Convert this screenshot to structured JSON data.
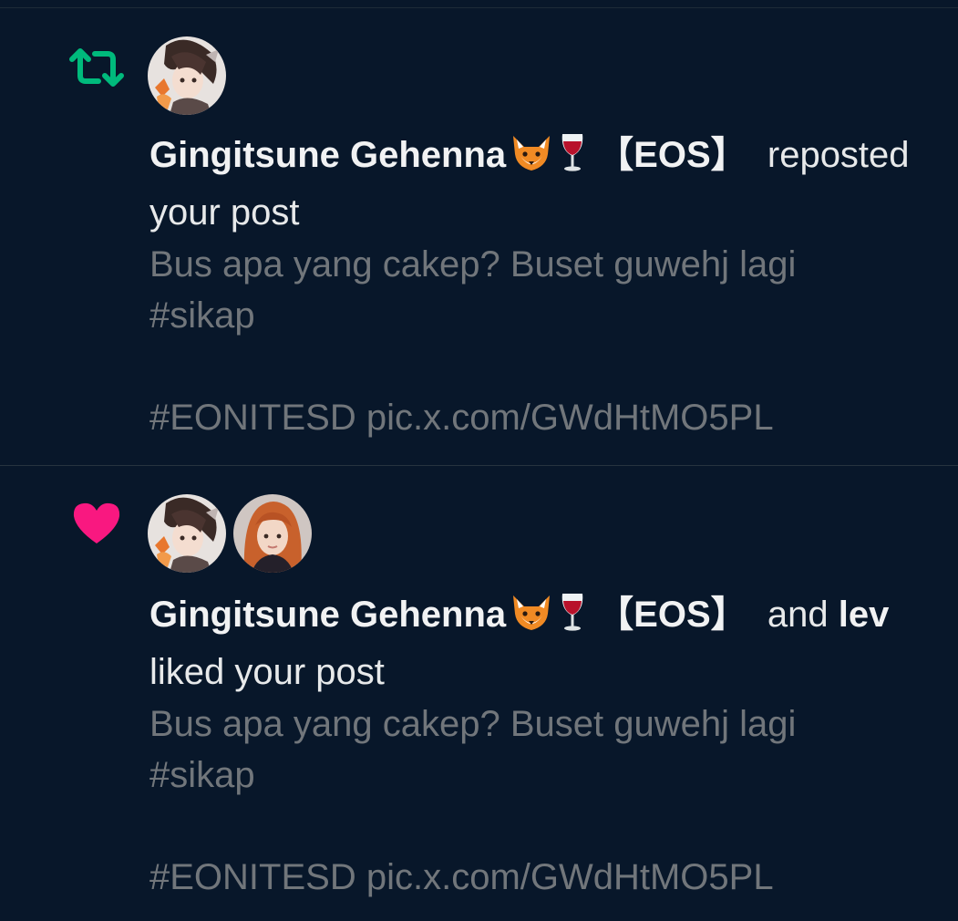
{
  "notifications": [
    {
      "type": "repost",
      "icon": "repost-icon",
      "icon_color": "#00ba7c",
      "actor_name": "Gingitsune Gehenna",
      "actor_emojis": [
        "🦊",
        "🍷"
      ],
      "actor_tag": "【EOS】",
      "action": "reposted your post",
      "post_lines": [
        "Bus apa yang cakep? Buset guwehj lagi",
        "#sikap",
        "",
        "#EONITESD pic.x.com/GWdHtMO5PL"
      ]
    },
    {
      "type": "like",
      "icon": "heart-icon",
      "icon_color": "#f91880",
      "actor_name": "Gingitsune Gehenna",
      "actor_emojis": [
        "🦊",
        "🍷"
      ],
      "actor_tag": "【EOS】",
      "connector": "and",
      "second_actor": "lev",
      "action": "liked your post",
      "post_lines": [
        "Bus apa yang cakep? Buset guwehj lagi",
        "#sikap",
        "",
        "#EONITESD pic.x.com/GWdHtMO5PL"
      ]
    }
  ],
  "colors": {
    "background": "#08172a",
    "primary_text": "#e7e9ea",
    "secondary_text": "#71767b",
    "divider": "#27333f"
  }
}
